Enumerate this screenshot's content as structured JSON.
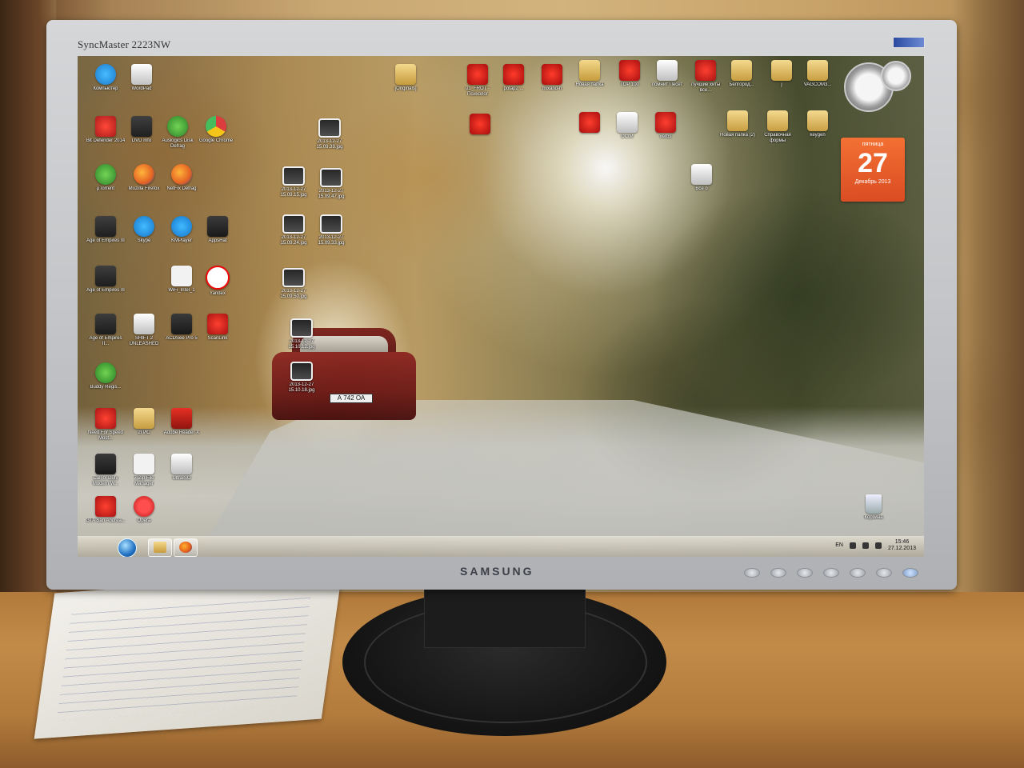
{
  "monitor": {
    "model": "SyncMaster 2223NW",
    "brand": "SAMSUNG"
  },
  "desktop": {
    "icons": [
      {
        "id": "computer",
        "label": "Компьютер",
        "icon": "computer-icon",
        "style": "blue"
      },
      {
        "id": "word",
        "label": "WordPad",
        "icon": "document-icon",
        "style": "doc"
      },
      {
        "id": "originals",
        "label": "[Originals]",
        "icon": "folder-icon",
        "style": "folder"
      },
      {
        "id": "mp3-1",
        "label": "01_FROT - Психолог",
        "icon": "mp3-icon",
        "style": "red"
      },
      {
        "id": "mp3-2",
        "label": "potap2 ...",
        "icon": "mp3-icon",
        "style": "red"
      },
      {
        "id": "mp3-3",
        "label": "mixand-h",
        "icon": "mp3-icon",
        "style": "red"
      },
      {
        "id": "folder-new-1",
        "label": "Новая папка",
        "icon": "folder-icon",
        "style": "folder"
      },
      {
        "id": "top100",
        "label": "TOP 100",
        "icon": "media-icon",
        "style": "red"
      },
      {
        "id": "pomnit",
        "label": "помнит Песет",
        "icon": "media-icon",
        "style": "doc"
      },
      {
        "id": "luchshie",
        "label": "Лучшие хиты все...",
        "icon": "media-icon",
        "style": "red"
      },
      {
        "id": "belgorod",
        "label": "Белгород...",
        "icon": "folder-icon",
        "style": "folder"
      },
      {
        "id": "folder-j",
        "label": "j",
        "icon": "folder-icon",
        "style": "folder"
      },
      {
        "id": "vagcom",
        "label": "VAGCOM3...",
        "icon": "folder-icon",
        "style": "folder"
      },
      {
        "id": "yahoo",
        "label": "Bit Defender 2014",
        "icon": "app-icon",
        "style": "red"
      },
      {
        "id": "dvd",
        "label": "DVD Info",
        "icon": "app-icon",
        "style": "dark"
      },
      {
        "id": "diskdefrag",
        "label": "Auslogics Disk Defrag",
        "icon": "app-icon",
        "style": "green"
      },
      {
        "id": "chrome",
        "label": "Google Chrome",
        "icon": "chrome-icon",
        "style": "chrome"
      },
      {
        "id": "mp3-4",
        "label": "",
        "icon": "mp3-icon",
        "style": "red"
      },
      {
        "id": "photo-1",
        "label": "2013-12-27 15.09.39.jpg",
        "icon": "image-icon",
        "style": "photo"
      },
      {
        "id": "media-2",
        "label": "",
        "icon": "media-icon",
        "style": "red"
      },
      {
        "id": "dcim",
        "label": "DCIM",
        "icon": "media-icon",
        "style": "doc"
      },
      {
        "id": "media-4",
        "label": "verbs",
        "icon": "media-icon",
        "style": "red"
      },
      {
        "id": "folder-new-2",
        "label": "Новая папка (2)",
        "icon": "folder-icon",
        "style": "folder"
      },
      {
        "id": "spravka",
        "label": "Справочная формы",
        "icon": "folder-icon",
        "style": "folder"
      },
      {
        "id": "keygen",
        "label": "keygen",
        "icon": "folder-icon",
        "style": "folder"
      },
      {
        "id": "utorrent",
        "label": "µTorrent",
        "icon": "utorrent-icon",
        "style": "green"
      },
      {
        "id": "firefox",
        "label": "Mozilla Firefox",
        "icon": "firefox-icon",
        "style": "firefox"
      },
      {
        "id": "netfix",
        "label": "NetFix Defrag",
        "icon": "app-icon",
        "style": "firefox"
      },
      {
        "id": "photo-2",
        "label": "2013-12-27 15.09.15.jpg",
        "icon": "image-icon",
        "style": "photo"
      },
      {
        "id": "photo-3",
        "label": "2013-12-27 15.09.47.jpg",
        "icon": "image-icon",
        "style": "photo"
      },
      {
        "id": "vce",
        "label": "Все о",
        "icon": "document-icon",
        "style": "doc"
      },
      {
        "id": "aoe",
        "label": "Age of Empires III",
        "icon": "game-icon",
        "style": "dark"
      },
      {
        "id": "skype",
        "label": "Skype",
        "icon": "skype-icon",
        "style": "blue"
      },
      {
        "id": "kmplayer",
        "label": "KMPlayer",
        "icon": "app-icon",
        "style": "blue"
      },
      {
        "id": "appshat",
        "label": "AppsHat",
        "icon": "app-icon",
        "style": "dark"
      },
      {
        "id": "photo-4",
        "label": "2013-12-27 15.09.24.jpg",
        "icon": "image-icon",
        "style": "photo"
      },
      {
        "id": "photo-5",
        "label": "2013-12-27 15.09.33.jpg",
        "icon": "image-icon",
        "style": "photo"
      },
      {
        "id": "aoe2",
        "label": "Age of Empires III",
        "icon": "game-icon",
        "style": "dark"
      },
      {
        "id": "wifi",
        "label": "WiFi_Intel_1",
        "icon": "zip-icon",
        "style": "zip"
      },
      {
        "id": "yandex",
        "label": "Yandex",
        "icon": "yandex-icon",
        "style": "yandex"
      },
      {
        "id": "photo-6",
        "label": "2013-12-27 15.09.50.jpg",
        "icon": "image-icon",
        "style": "photo"
      },
      {
        "id": "aoe3",
        "label": "Age of Empires II...",
        "icon": "game-icon",
        "style": "dark"
      },
      {
        "id": "shift2",
        "label": "SHIFT 2 UNLEASHED",
        "icon": "game-icon",
        "style": "doc"
      },
      {
        "id": "acdsee",
        "label": "ACDSee Pro 5",
        "icon": "app-icon",
        "style": "dark"
      },
      {
        "id": "scanlink",
        "label": "ScanLink",
        "icon": "app-icon",
        "style": "red"
      },
      {
        "id": "photo-7",
        "label": "2013-12-27 15.10.12.jpg",
        "icon": "image-icon",
        "style": "photo"
      },
      {
        "id": "buddy",
        "label": "Buddy Regis...",
        "icon": "app-icon",
        "style": "green"
      },
      {
        "id": "photo-8",
        "label": "2013-12-27 15.10.18.jpg",
        "icon": "image-icon",
        "style": "photo"
      },
      {
        "id": "nfs",
        "label": "Need For Speed Most...",
        "icon": "game-icon",
        "style": "red"
      },
      {
        "id": "2gis",
        "label": "2ГИС",
        "icon": "app-icon",
        "style": "folder"
      },
      {
        "id": "adobe",
        "label": "Adobe Reader X",
        "icon": "pdf-icon",
        "style": "pdf"
      },
      {
        "id": "cod",
        "label": "Call of Duty Modern W...",
        "icon": "game-icon",
        "style": "dark"
      },
      {
        "id": "7zip",
        "label": "7-Zip File Manager",
        "icon": "zip-icon",
        "style": "zip"
      },
      {
        "id": "ultraiso",
        "label": "UltraISO",
        "icon": "disc-icon",
        "style": "doc"
      },
      {
        "id": "gta",
        "label": "GTA San Andrea...",
        "icon": "game-icon",
        "style": "red"
      },
      {
        "id": "opera",
        "label": "Opera",
        "icon": "opera-icon",
        "style": "opera"
      }
    ],
    "calendar": {
      "day_name": "пятница",
      "day_number": "27",
      "month_year": "Декабрь 2013"
    },
    "recycle_bin": {
      "label": "Корзина",
      "icon": "recycle-bin-icon"
    }
  },
  "taskbar": {
    "items": [
      {
        "name": "start-orb",
        "icon": "windows-start-icon"
      },
      {
        "name": "explorer",
        "icon": "folder-icon"
      },
      {
        "name": "firefox",
        "icon": "firefox-icon"
      }
    ],
    "language": "EN",
    "time": "15:46",
    "date": "27.12.2013"
  },
  "car": {
    "plate": "А 742 ОА"
  }
}
